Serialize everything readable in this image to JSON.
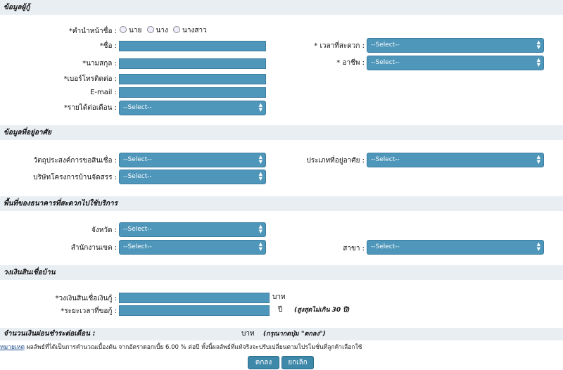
{
  "borrower": {
    "header": "ข้อมูลผู้กู้",
    "title_label": "*คำนำหน้าชื่อ :",
    "title_options": [
      "นาย",
      "นาง",
      "นางสาว"
    ],
    "name_label": "*ชื่อ :",
    "surname_label": "*นามสกุล :",
    "phone_label": "*เบอร์โทรติดต่อ :",
    "email_label": "E-mail :",
    "income_label": "*รายได้ต่อเดือน :",
    "contact_time_label": "* เวลาที่สะดวก :",
    "occupation_label": "* อาชีพ :"
  },
  "residence": {
    "header": "ข้อมูลที่อยู่อาศัย",
    "purpose_label": "วัตถุประสงค์การขอสินเชื่อ :",
    "developer_label": "บริษัทโครงการบ้านจัดสรร :",
    "type_label": "ประเภทที่อยู่อาศัย :"
  },
  "branch": {
    "header": "พื้นที่ของธนาคารที่สะดวกไปใช้บริการ",
    "province_label": "จังหวัด :",
    "district_label": "สำนักงานเขต :",
    "branch_label": "สาขา :"
  },
  "loan": {
    "header": "วงเงินสินเชื่อบ้าน",
    "amount_label": "*วงเงินสินเชื่อเงินกู้ :",
    "amount_unit": "บาท",
    "term_label": "*ระยะเวลาที่ขอกู้ :",
    "term_unit": "ปี",
    "term_note": "(สูงสุดไม่เกิน 30 ปี)"
  },
  "select_placeholder": "--Select--",
  "result": {
    "label": "จำนวนเงินผ่อนชำระต่อเดือน :",
    "unit": "บาท",
    "hint": "(กรุณากดปุ่ม \"ตกลง\")"
  },
  "note": {
    "link": "หมายเหตุ",
    "text": "ผลลัพธ์ที่ได้เป็นการคำนวณเบื้องต้น จากอัตราดอกเบี้ย 6.00 % ต่อปี ทั้งนี้ผลลัพธ์ที่แท้จริงจะปรับเปลี่ยนตามโปรโมชั่นที่ลูกค้าเลือกใช้"
  },
  "buttons": {
    "ok": "ตกลง",
    "cancel": "ยกเลิก"
  },
  "colors": {
    "field": "#4e96ba",
    "section_bg": "#e9eef3"
  }
}
